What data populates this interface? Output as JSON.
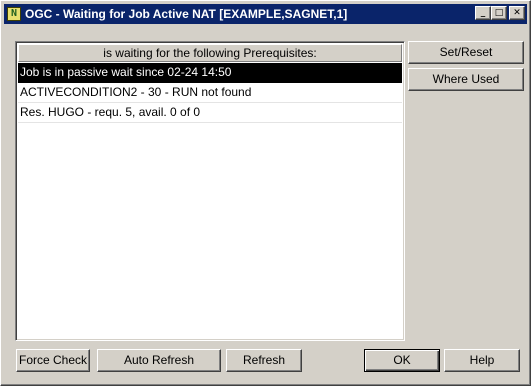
{
  "window": {
    "title": "OGC - Waiting for Job Active NAT [EXAMPLE,SAGNET,1]",
    "icon_glyph": "N",
    "controls": {
      "minimize": "_",
      "maximize": "□",
      "close": "✕"
    }
  },
  "list": {
    "header": "is waiting for the following Prerequisites:",
    "rows": [
      "Job is in passive wait since 02-24 14:50",
      "ACTIVECONDITION2 - 30 - RUN not found",
      "Res. HUGO - requ. 5, avail. 0 of 0"
    ],
    "selected_index": 0
  },
  "side_buttons": {
    "set_reset": "Set/Reset",
    "where_used": "Where Used"
  },
  "bottom_buttons": {
    "force_check": "Force Check",
    "auto_refresh": "Auto Refresh",
    "refresh": "Refresh",
    "ok": "OK",
    "help": "Help"
  },
  "colors": {
    "titlebar": "#0a246a",
    "face": "#d4d0c8",
    "selection": "#000000"
  }
}
